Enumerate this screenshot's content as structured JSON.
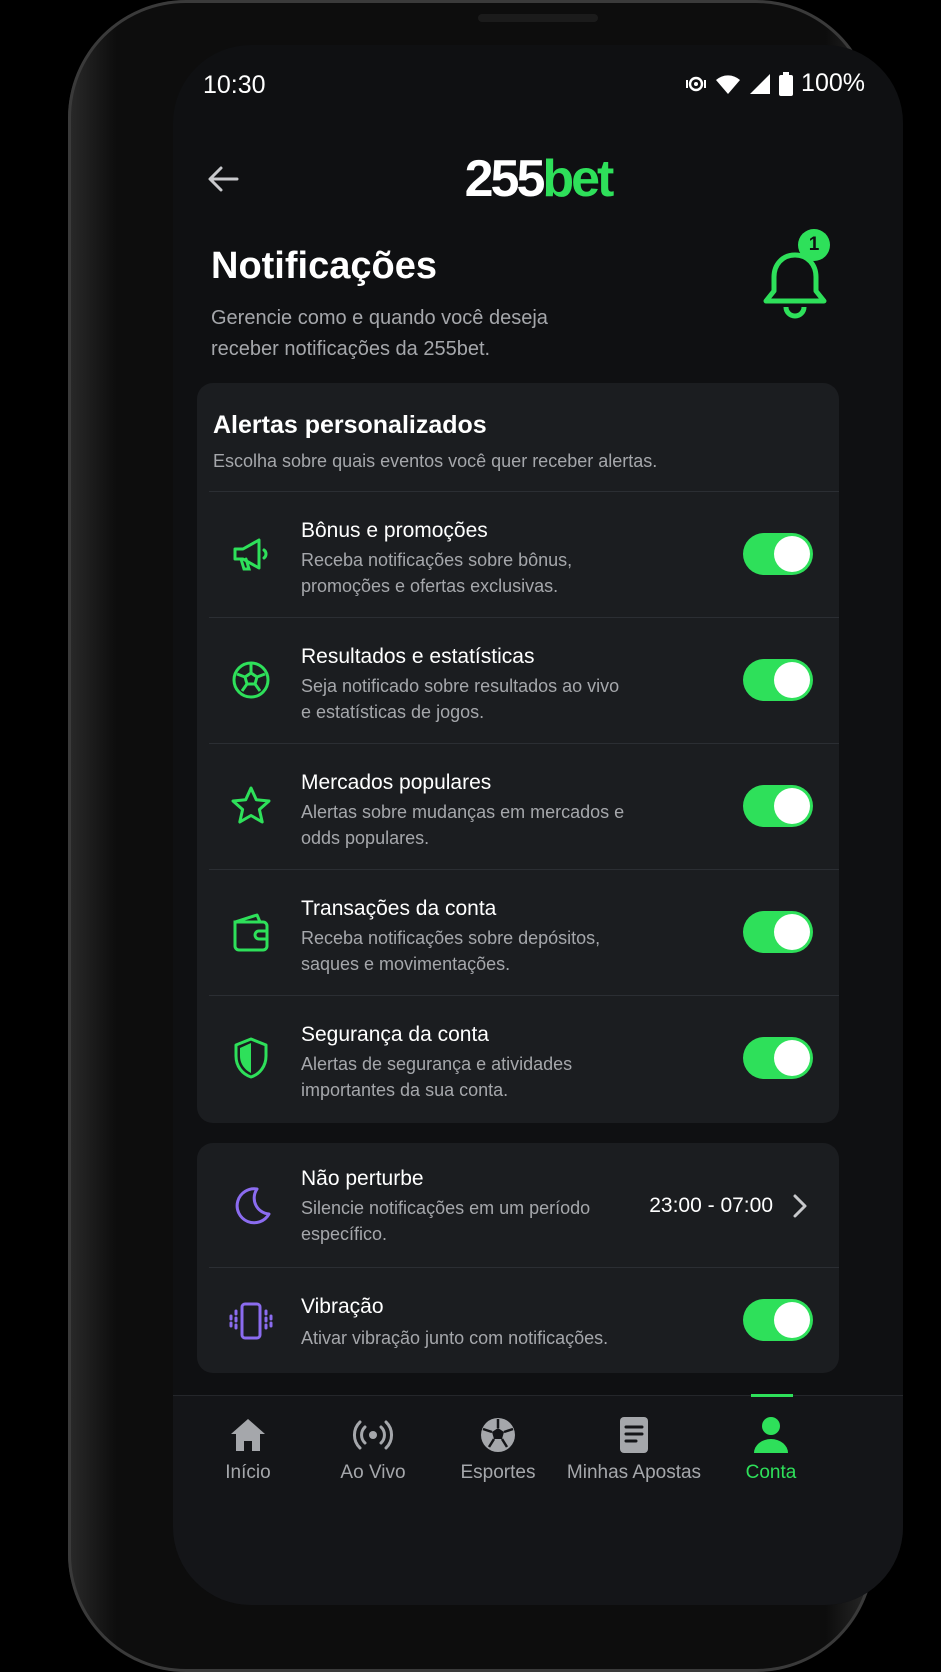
{
  "status_bar": {
    "time": "10:30",
    "battery": "100%"
  },
  "header": {
    "logo_main": "255",
    "logo_accent": "bet"
  },
  "page": {
    "title": "Notificações",
    "subtitle": "Gerencie como e quando você deseja receber notificações da 255bet.",
    "badge_count": "1"
  },
  "alerts": {
    "title": "Alertas personalizados",
    "subtitle": "Escolha sobre quais eventos você quer receber alertas.",
    "items": [
      {
        "title": "Bônus e promoções",
        "desc": "Receba notificações sobre bônus, promoções e ofertas exclusivas.",
        "icon": "megaphone-icon",
        "enabled": true
      },
      {
        "title": "Resultados e estatísticas",
        "desc": "Seja notificado sobre resultados ao vivo e estatísticas de jogos.",
        "icon": "soccer-ball-icon",
        "enabled": true
      },
      {
        "title": "Mercados populares",
        "desc": "Alertas sobre mudanças em mercados e odds populares.",
        "icon": "star-icon",
        "enabled": true
      },
      {
        "title": "Transações da conta",
        "desc": "Receba notificações sobre depósitos, saques e movimentações.",
        "icon": "wallet-icon",
        "enabled": true
      },
      {
        "title": "Segurança da conta",
        "desc": "Alertas de segurança e atividades importantes da sua conta.",
        "icon": "shield-icon",
        "enabled": true
      }
    ]
  },
  "settings": {
    "dnd": {
      "title": "Não perturbe",
      "desc": "Silencie notificações em um período específico.",
      "value": "23:00 - 07:00",
      "icon": "moon-icon"
    },
    "vibration": {
      "title": "Vibração",
      "desc": "Ativar vibração junto com notificações.",
      "icon": "vibration-icon",
      "enabled": true
    }
  },
  "nav": {
    "items": [
      {
        "label": "Início",
        "icon": "home-icon"
      },
      {
        "label": "Ao Vivo",
        "icon": "live-icon"
      },
      {
        "label": "Esportes",
        "icon": "soccer-ball-icon"
      },
      {
        "label": "Minhas Apostas",
        "icon": "bets-icon"
      },
      {
        "label": "Conta",
        "icon": "user-icon"
      }
    ],
    "active": "Conta"
  },
  "colors": {
    "accent": "#2ee05a",
    "background": "#0f1012",
    "card": "#1b1d20",
    "purple": "#8b6cf0"
  }
}
